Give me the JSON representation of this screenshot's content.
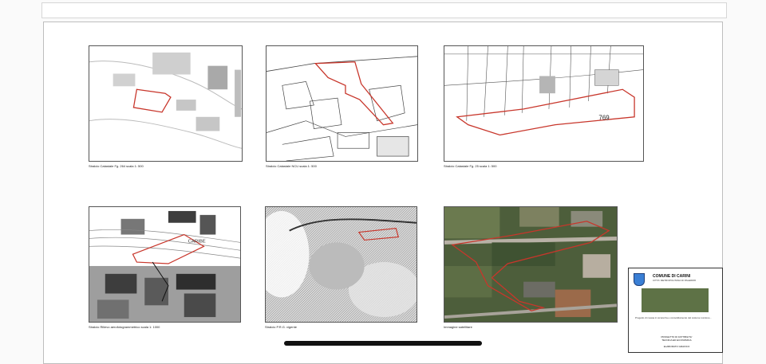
{
  "panels": [
    {
      "id": "p1",
      "caption": "Stralcio Catastale Fg. 264 scala 1: 500"
    },
    {
      "id": "p2",
      "caption": "Stralcio Catastale NCU scala 1: 500"
    },
    {
      "id": "p3",
      "caption": "Stralcio Catastale Fg. 25 scala 1: 500",
      "parcel_label": "769"
    },
    {
      "id": "p4",
      "caption": "Stralcio Rilievo aerofotogrammetrico scala 1: 1000",
      "place_label": "CARIBE"
    },
    {
      "id": "p5",
      "caption": "Stralcio P.R.G. vigente"
    },
    {
      "id": "p6",
      "caption": "Immagine satellitare"
    }
  ],
  "title_block": {
    "title": "COMUNE DI CARINI",
    "subtitle": "CITTA' METROPOLITANA DI PALERMO",
    "description": "Progetto di messa in sicurezza e consolidamento del costone roccioso...",
    "row1": "PROGETTO DI FATTIBILITA'",
    "row2": "TECNICA ED ECONOMICA",
    "row3": "ELABORATO GRAFICO"
  },
  "colors": {
    "parcel_outline": "#c8362b",
    "sheet_border": "#bdbdbd"
  }
}
